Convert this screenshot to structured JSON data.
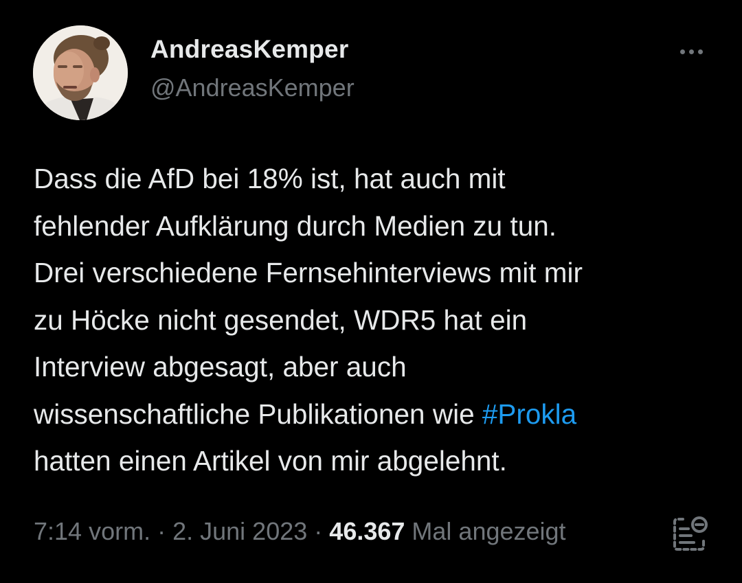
{
  "author": {
    "display_name": "AndreasKemper",
    "handle": "@AndreasKemper"
  },
  "menu": {
    "icon": "more-horizontal-icon"
  },
  "tweet": {
    "lines": [
      "Dass die AfD bei 18% ist, hat auch mit",
      "fehlender Aufklärung durch Medien zu tun.",
      "Drei verschiedene Fernsehinterviews mit mir",
      "zu Höcke nicht gesendet, WDR5 hat ein",
      "Interview abgesagt, aber auch",
      "wissenschaftliche Publikationen wie ",
      "hatten einen Artikel von mir abgelehnt."
    ],
    "hashtag": "#Prokla"
  },
  "meta": {
    "time": "7:14 vorm.",
    "separator": "·",
    "date": "2. Juni 2023",
    "views_count": "46.367",
    "views_label": "Mal angezeigt"
  },
  "actions": {
    "analytics_icon": "bookmark-notes-icon"
  },
  "colors": {
    "background": "#000000",
    "text_primary": "#e7e9ea",
    "text_secondary": "#71767b",
    "link": "#1d9bf0"
  }
}
